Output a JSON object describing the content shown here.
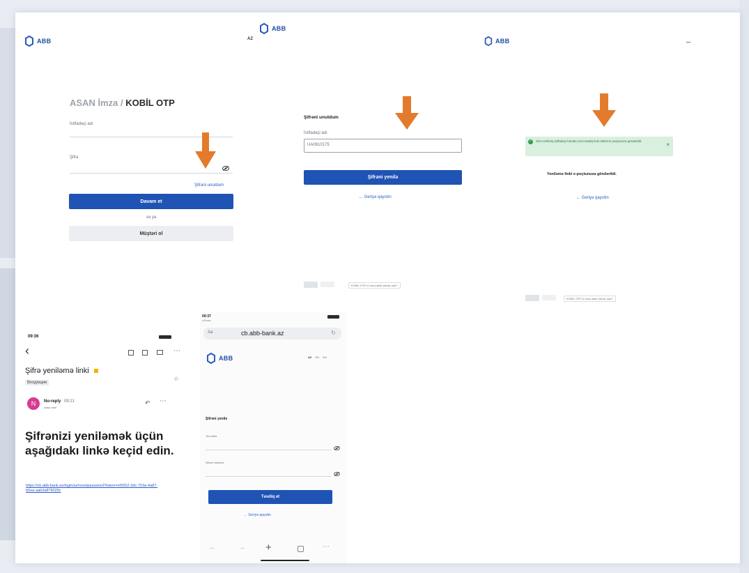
{
  "brand": {
    "logo_text": "ABB",
    "primary_color": "#1f53b4",
    "accent_arrow_color": "#e47b2c"
  },
  "login": {
    "title_part1": "ASAN İmza /",
    "title_part2": "KOBİL OTP",
    "username_label": "İstifadəçi adı",
    "password_label": "Şifrə",
    "forgot_link": "Şifrəni unutdum",
    "continue_button": "Davam et",
    "or_text": "və ya",
    "become_client_button": "Müştəri ol"
  },
  "forgot": {
    "lang": "AZ",
    "heading": "Şifrəni unutdum",
    "username_label": "İstifadəçi adı",
    "username_value": "UA0610175",
    "reset_button": "Şifrəni yenilə",
    "back_link": "← Geriyə qayıdın",
    "footer_text": "KOBİL OTP-ni necə aktiv etmək olar?"
  },
  "sent": {
    "success_alert": "Sizə verilmiş istifadəçi hesabı üzrə təsdiq linki elektron poçtunuza göndərildi.",
    "message": "Yeniləmə linki e-poçtunuza göndərildi.",
    "back_link": "← Geriyə qayıdın",
    "footer_text": "KOBİL OTP-ni necə aktiv etmək olar?"
  },
  "email": {
    "time": "09:36",
    "subject": "Şifrə yeniləmə linki",
    "folder_badge": "Входящие",
    "sender": "No-reply",
    "sender_time": "09:21",
    "recipient_line": "кому: мне",
    "avatar_letter": "N",
    "body": "Şifrənizi yeniləmək üçün aşağıdakı linkə keçid edin.",
    "reset_url": "https://cb.abb-bank.az/login/az/resetpassword?token=ef2652-3dc-753a-4a87-b5ea-aab2a879029c"
  },
  "mobile": {
    "time": "09:37",
    "carrier": "◂ Почта",
    "url": "cb.abb-bank.az",
    "lang_az": "AZ",
    "lang_ru": "RU",
    "lang_en": "EN",
    "heading": "Şifrəni yenilə",
    "new_password_label": "Yeni şifrə",
    "confirm_password_label": "Şifrəni təkrarla",
    "confirm_button": "Təsdiq et",
    "back_link": "← Geriyə qayıdın"
  },
  "icons": {
    "eye": "⌀",
    "back": "‹",
    "star": "☆",
    "reply": "↶",
    "more": "⋯",
    "close": "×",
    "check": "✓",
    "plus": "+",
    "left": "←",
    "right": "→"
  }
}
